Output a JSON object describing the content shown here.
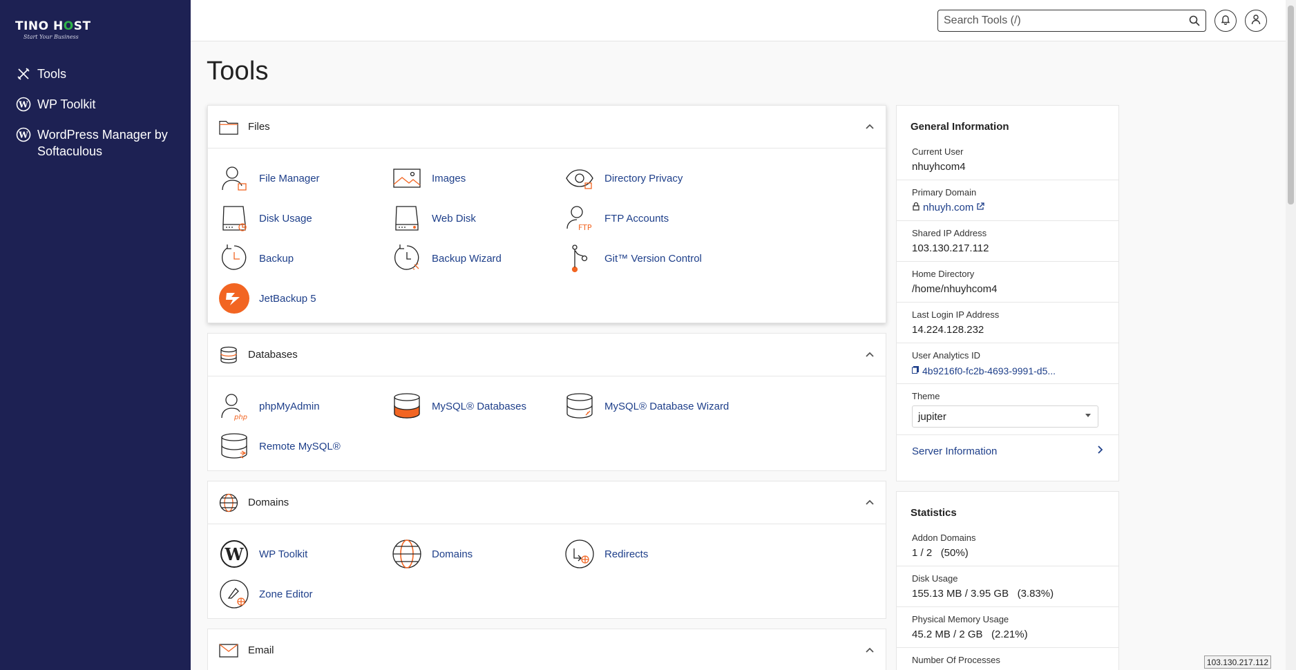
{
  "brand": {
    "name_part1": "TINO H",
    "name_o": "O",
    "name_part2": "ST",
    "tagline": "Start Your Business"
  },
  "sidebar": {
    "items": [
      {
        "label": "Tools",
        "icon": "tools-icon"
      },
      {
        "label": "WP Toolkit",
        "icon": "wordpress-icon"
      },
      {
        "label": "WordPress Manager by Softaculous",
        "icon": "wordpress-icon"
      }
    ]
  },
  "header": {
    "search_placeholder": "Search Tools (/)"
  },
  "page": {
    "title": "Tools"
  },
  "sections": {
    "files": {
      "title": "Files",
      "tools": [
        "File Manager",
        "Images",
        "Directory Privacy",
        "Disk Usage",
        "Web Disk",
        "FTP Accounts",
        "Backup",
        "Backup Wizard",
        "Git™ Version Control",
        "JetBackup 5"
      ]
    },
    "databases": {
      "title": "Databases",
      "tools": [
        "phpMyAdmin",
        "MySQL® Databases",
        "MySQL® Database Wizard",
        "Remote MySQL®"
      ]
    },
    "domains": {
      "title": "Domains",
      "tools": [
        "WP Toolkit",
        "Domains",
        "Redirects",
        "Zone Editor"
      ]
    },
    "email": {
      "title": "Email"
    }
  },
  "general_info": {
    "title": "General Information",
    "current_user_label": "Current User",
    "current_user": "nhuyhcom4",
    "primary_domain_label": "Primary Domain",
    "primary_domain": "nhuyh.com",
    "shared_ip_label": "Shared IP Address",
    "shared_ip": "103.130.217.112",
    "home_dir_label": "Home Directory",
    "home_dir": "/home/nhuyhcom4",
    "last_login_label": "Last Login IP Address",
    "last_login": "14.224.128.232",
    "analytics_label": "User Analytics ID",
    "analytics_id": "4b9216f0-fc2b-4693-9991-d5...",
    "theme_label": "Theme",
    "theme": "jupiter",
    "server_info": "Server Information"
  },
  "statistics": {
    "title": "Statistics",
    "addon_domains_label": "Addon Domains",
    "addon_domains": "1 / 2   (50%)",
    "disk_usage_label": "Disk Usage",
    "disk_usage": "155.13 MB / 3.95 GB   (3.83%)",
    "memory_label": "Physical Memory Usage",
    "memory": "45.2 MB / 2 GB   (2.21%)",
    "processes_label": "Number Of Processes"
  },
  "status_bar": {
    "ip": "103.130.217.112"
  },
  "colors": {
    "sidebar": "#1d2153",
    "link": "#1e3f8a",
    "accent": "#f26522",
    "logo_green": "#2fb24a"
  }
}
